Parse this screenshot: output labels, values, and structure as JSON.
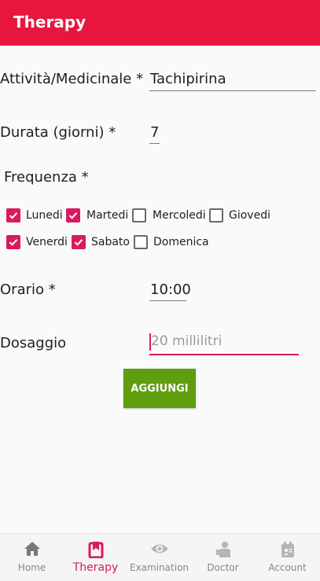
{
  "appbar": {
    "title": "Therapy"
  },
  "form": {
    "activity": {
      "label": "Attività/Medicinale *",
      "value": "Tachipirina"
    },
    "duration": {
      "label": "Durata (giorni) *",
      "value": "7"
    },
    "frequency": {
      "label": "Frequenza *",
      "days": [
        {
          "label": "Lunedi",
          "checked": true
        },
        {
          "label": "Martedi",
          "checked": true
        },
        {
          "label": "Mercoledi",
          "checked": false
        },
        {
          "label": "Giovedi",
          "checked": false
        },
        {
          "label": "Venerdi",
          "checked": true
        },
        {
          "label": "Sabato",
          "checked": true
        },
        {
          "label": "Domenica",
          "checked": false
        }
      ]
    },
    "time": {
      "label": "Orario *",
      "value": "10:00"
    },
    "dosage": {
      "label": "Dosaggio",
      "placeholder": "20 millilitri",
      "value": ""
    },
    "submit_label": "AGGIUNGI"
  },
  "bottom_nav": {
    "items": [
      {
        "label": "Home",
        "icon": "home-icon",
        "active": false
      },
      {
        "label": "Therapy",
        "icon": "therapy-icon",
        "active": true
      },
      {
        "label": "Examination",
        "icon": "eye-icon",
        "active": false
      },
      {
        "label": "Doctor",
        "icon": "doctor-icon",
        "active": false
      },
      {
        "label": "Account",
        "icon": "account-icon",
        "active": false
      }
    ]
  },
  "colors": {
    "accent": "#e8163f",
    "checkbox": "#d81b60",
    "button": "#5f9e0f"
  }
}
